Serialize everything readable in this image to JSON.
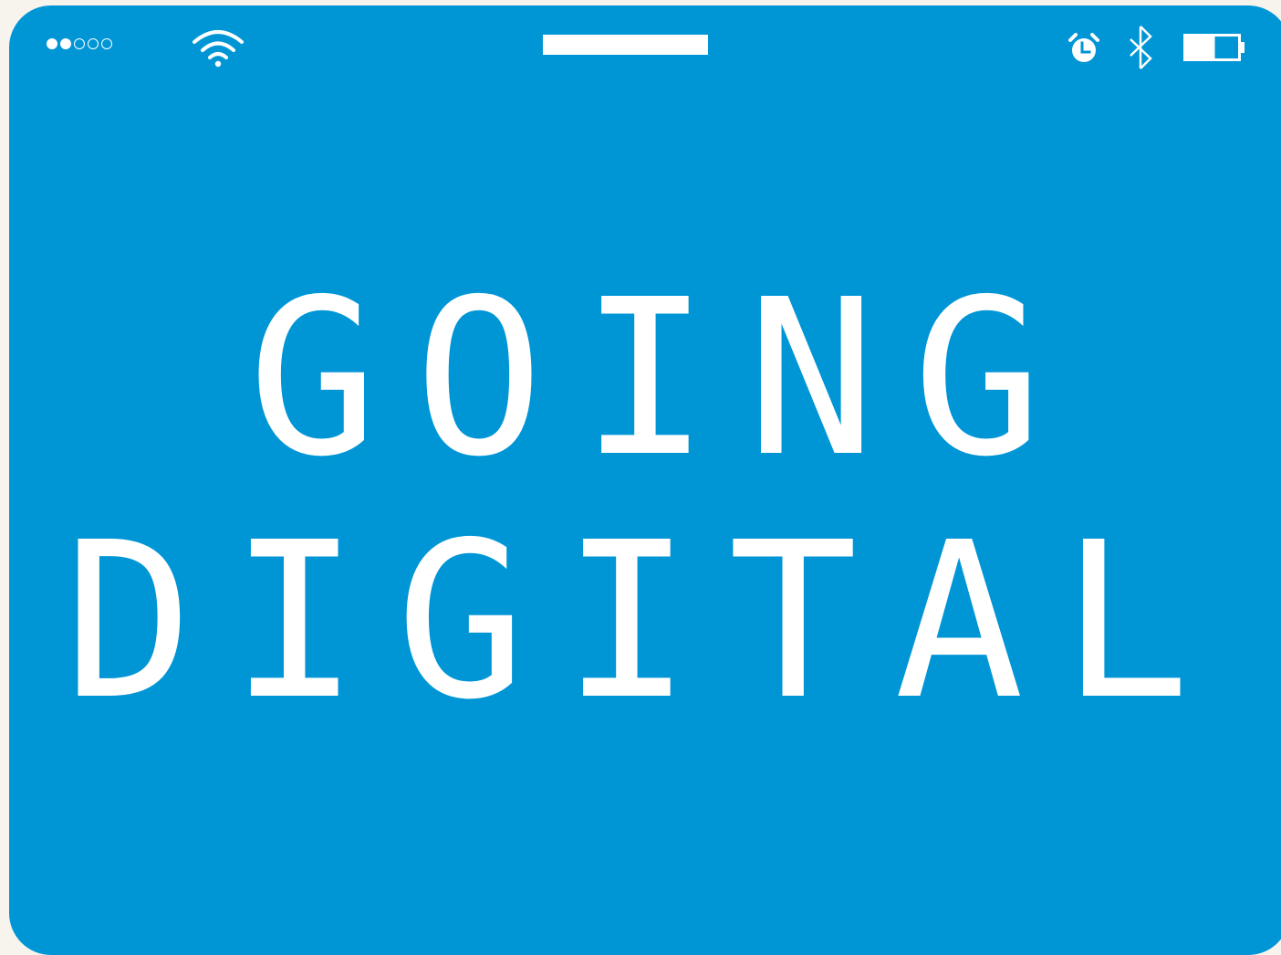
{
  "status_bar": {
    "signal_strength": {
      "filled": 2,
      "total": 5
    },
    "icons": [
      "wifi-icon",
      "alarm-icon",
      "bluetooth-icon",
      "battery-icon"
    ],
    "battery_level_percent": 50
  },
  "hero": {
    "line1": "GOING",
    "line2": "DIGITAL"
  },
  "colors": {
    "screen_background": "#0096D6",
    "page_background": "#F7F3ED",
    "foreground": "#FFFFFF"
  }
}
